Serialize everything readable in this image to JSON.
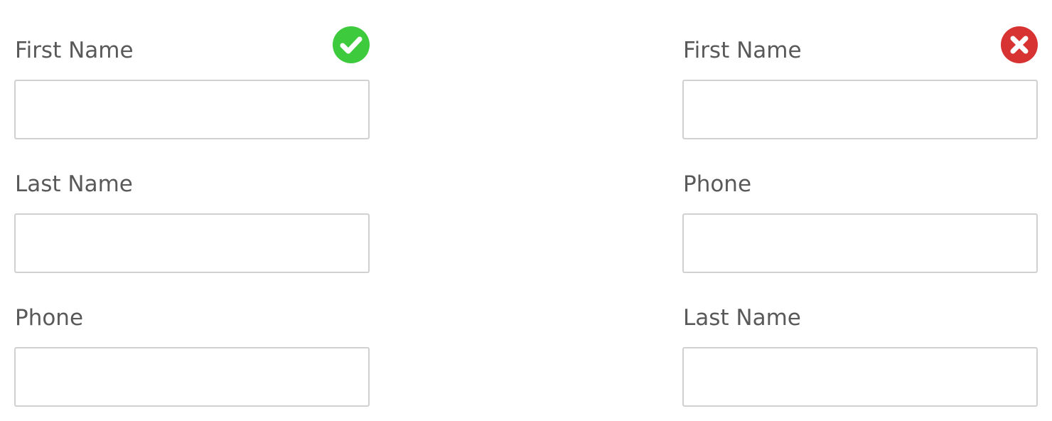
{
  "forms": [
    {
      "status": "correct",
      "status_icon": "check-circle-icon",
      "status_color": "#3dca3d",
      "fields": [
        {
          "label": "First Name",
          "value": ""
        },
        {
          "label": "Last Name",
          "value": ""
        },
        {
          "label": "Phone",
          "value": ""
        }
      ]
    },
    {
      "status": "incorrect",
      "status_icon": "x-circle-icon",
      "status_color": "#d83333",
      "fields": [
        {
          "label": "First Name",
          "value": ""
        },
        {
          "label": "Phone",
          "value": ""
        },
        {
          "label": "Last Name",
          "value": ""
        }
      ]
    }
  ],
  "colors": {
    "label_text": "#595959",
    "input_border": "#d0d0d0",
    "background": "#ffffff"
  }
}
